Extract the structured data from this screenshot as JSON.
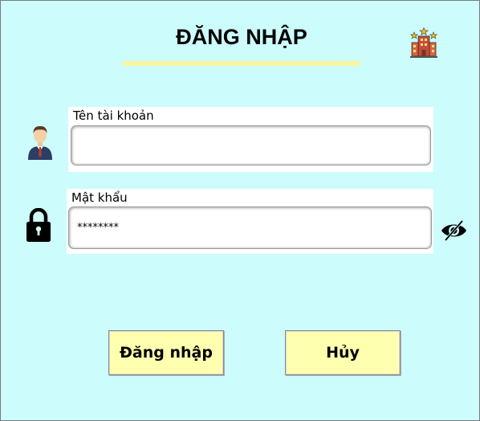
{
  "header": {
    "title": "ĐĂNG NHẬP",
    "accent_color": "#fbf5a0",
    "icon": "hotel-icon"
  },
  "background_color": "#ccfcfc",
  "username": {
    "label": "Tên tài khoản",
    "value": "",
    "icon": "user-icon"
  },
  "password": {
    "label": "Mật khẩu",
    "value": "********",
    "icon": "lock-icon",
    "toggle_icon": "eye-slash-icon"
  },
  "buttons": {
    "login_label": "Đăng nhập",
    "cancel_label": "Hủy",
    "color": "#ffffb0"
  }
}
